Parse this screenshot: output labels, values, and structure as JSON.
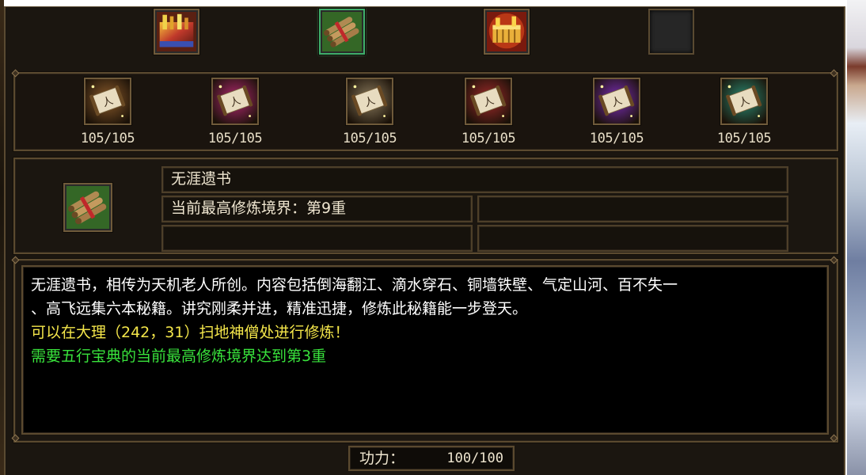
{
  "top_slots": [
    {
      "icon": "golden-book-icon",
      "state": "filled"
    },
    {
      "icon": "bamboo-scroll-bundle-icon",
      "state": "selected"
    },
    {
      "icon": "gold-treasure-chest-icon",
      "state": "filled"
    },
    {
      "icon": "empty-slot",
      "state": "empty"
    }
  ],
  "scrolls": [
    {
      "icon": "brown-skill-scroll-icon",
      "color": "#8a5a2a",
      "count": "105/105"
    },
    {
      "icon": "magenta-skill-scroll-icon",
      "color": "#b0286f",
      "count": "105/105"
    },
    {
      "icon": "tan-skill-scroll-icon",
      "color": "#8a7a5c",
      "count": "105/105"
    },
    {
      "icon": "red-skill-scroll-icon",
      "color": "#a02a2a",
      "count": "105/105"
    },
    {
      "icon": "purple-skill-scroll-icon",
      "color": "#7b2db8",
      "count": "105/105"
    },
    {
      "icon": "teal-skill-scroll-icon",
      "color": "#2a8a72",
      "count": "105/105"
    }
  ],
  "selected": {
    "icon": "bamboo-scroll-bundle-icon",
    "name": "无涯遗书",
    "realm": "当前最高修炼境界：第9重",
    "field_right_1": "",
    "field_left_2": "",
    "field_right_2": ""
  },
  "description": {
    "line1": "无涯遗书，相传为天机老人所创。内容包括倒海翻江、滴水穿石、铜墙铁壁、气定山河、百不失一",
    "line2": "、高飞远集六本秘籍。讲究刚柔并进，精准迅捷，修炼此秘籍能一步登天。",
    "location": "可以在大理（242，31）扫地神僧处进行修炼！",
    "requirement": "需要五行宝典的当前最高修炼境界达到第3重"
  },
  "power": {
    "label": "功力：",
    "value": "100/100"
  },
  "colors": {
    "panel_bg": "#1b1610",
    "frame": "#5b4a2f",
    "text_white": "#ffffff",
    "text_yellow": "#f4e64a",
    "text_green": "#39e33c"
  }
}
